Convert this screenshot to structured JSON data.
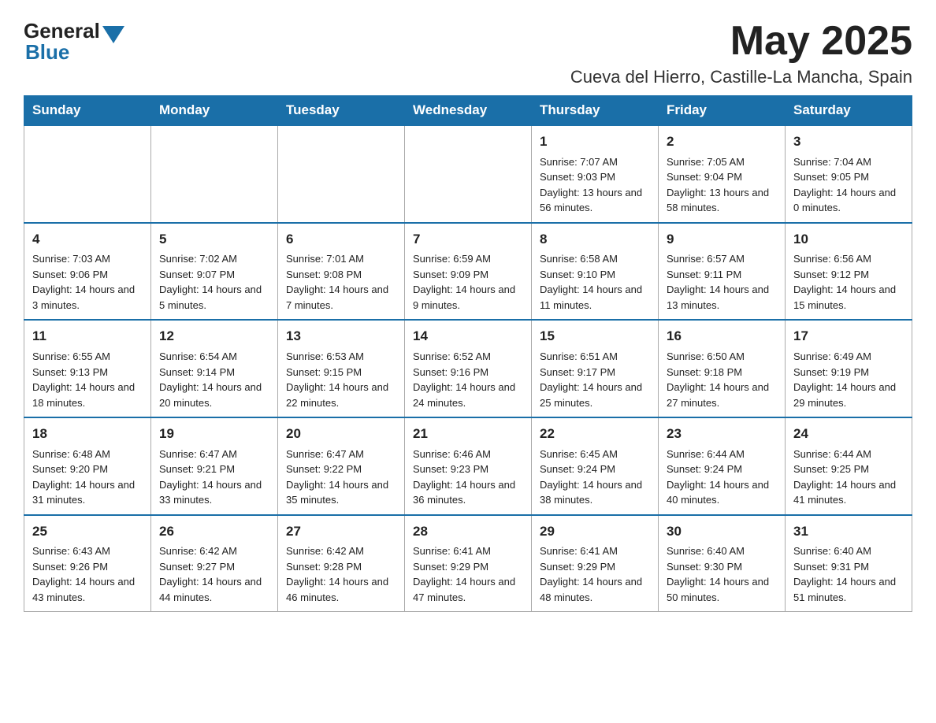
{
  "logo": {
    "general": "General",
    "blue": "Blue"
  },
  "title": {
    "month_year": "May 2025",
    "location": "Cueva del Hierro, Castille-La Mancha, Spain"
  },
  "weekdays": [
    "Sunday",
    "Monday",
    "Tuesday",
    "Wednesday",
    "Thursday",
    "Friday",
    "Saturday"
  ],
  "weeks": [
    [
      {
        "day": "",
        "info": ""
      },
      {
        "day": "",
        "info": ""
      },
      {
        "day": "",
        "info": ""
      },
      {
        "day": "",
        "info": ""
      },
      {
        "day": "1",
        "info": "Sunrise: 7:07 AM\nSunset: 9:03 PM\nDaylight: 13 hours and 56 minutes."
      },
      {
        "day": "2",
        "info": "Sunrise: 7:05 AM\nSunset: 9:04 PM\nDaylight: 13 hours and 58 minutes."
      },
      {
        "day": "3",
        "info": "Sunrise: 7:04 AM\nSunset: 9:05 PM\nDaylight: 14 hours and 0 minutes."
      }
    ],
    [
      {
        "day": "4",
        "info": "Sunrise: 7:03 AM\nSunset: 9:06 PM\nDaylight: 14 hours and 3 minutes."
      },
      {
        "day": "5",
        "info": "Sunrise: 7:02 AM\nSunset: 9:07 PM\nDaylight: 14 hours and 5 minutes."
      },
      {
        "day": "6",
        "info": "Sunrise: 7:01 AM\nSunset: 9:08 PM\nDaylight: 14 hours and 7 minutes."
      },
      {
        "day": "7",
        "info": "Sunrise: 6:59 AM\nSunset: 9:09 PM\nDaylight: 14 hours and 9 minutes."
      },
      {
        "day": "8",
        "info": "Sunrise: 6:58 AM\nSunset: 9:10 PM\nDaylight: 14 hours and 11 minutes."
      },
      {
        "day": "9",
        "info": "Sunrise: 6:57 AM\nSunset: 9:11 PM\nDaylight: 14 hours and 13 minutes."
      },
      {
        "day": "10",
        "info": "Sunrise: 6:56 AM\nSunset: 9:12 PM\nDaylight: 14 hours and 15 minutes."
      }
    ],
    [
      {
        "day": "11",
        "info": "Sunrise: 6:55 AM\nSunset: 9:13 PM\nDaylight: 14 hours and 18 minutes."
      },
      {
        "day": "12",
        "info": "Sunrise: 6:54 AM\nSunset: 9:14 PM\nDaylight: 14 hours and 20 minutes."
      },
      {
        "day": "13",
        "info": "Sunrise: 6:53 AM\nSunset: 9:15 PM\nDaylight: 14 hours and 22 minutes."
      },
      {
        "day": "14",
        "info": "Sunrise: 6:52 AM\nSunset: 9:16 PM\nDaylight: 14 hours and 24 minutes."
      },
      {
        "day": "15",
        "info": "Sunrise: 6:51 AM\nSunset: 9:17 PM\nDaylight: 14 hours and 25 minutes."
      },
      {
        "day": "16",
        "info": "Sunrise: 6:50 AM\nSunset: 9:18 PM\nDaylight: 14 hours and 27 minutes."
      },
      {
        "day": "17",
        "info": "Sunrise: 6:49 AM\nSunset: 9:19 PM\nDaylight: 14 hours and 29 minutes."
      }
    ],
    [
      {
        "day": "18",
        "info": "Sunrise: 6:48 AM\nSunset: 9:20 PM\nDaylight: 14 hours and 31 minutes."
      },
      {
        "day": "19",
        "info": "Sunrise: 6:47 AM\nSunset: 9:21 PM\nDaylight: 14 hours and 33 minutes."
      },
      {
        "day": "20",
        "info": "Sunrise: 6:47 AM\nSunset: 9:22 PM\nDaylight: 14 hours and 35 minutes."
      },
      {
        "day": "21",
        "info": "Sunrise: 6:46 AM\nSunset: 9:23 PM\nDaylight: 14 hours and 36 minutes."
      },
      {
        "day": "22",
        "info": "Sunrise: 6:45 AM\nSunset: 9:24 PM\nDaylight: 14 hours and 38 minutes."
      },
      {
        "day": "23",
        "info": "Sunrise: 6:44 AM\nSunset: 9:24 PM\nDaylight: 14 hours and 40 minutes."
      },
      {
        "day": "24",
        "info": "Sunrise: 6:44 AM\nSunset: 9:25 PM\nDaylight: 14 hours and 41 minutes."
      }
    ],
    [
      {
        "day": "25",
        "info": "Sunrise: 6:43 AM\nSunset: 9:26 PM\nDaylight: 14 hours and 43 minutes."
      },
      {
        "day": "26",
        "info": "Sunrise: 6:42 AM\nSunset: 9:27 PM\nDaylight: 14 hours and 44 minutes."
      },
      {
        "day": "27",
        "info": "Sunrise: 6:42 AM\nSunset: 9:28 PM\nDaylight: 14 hours and 46 minutes."
      },
      {
        "day": "28",
        "info": "Sunrise: 6:41 AM\nSunset: 9:29 PM\nDaylight: 14 hours and 47 minutes."
      },
      {
        "day": "29",
        "info": "Sunrise: 6:41 AM\nSunset: 9:29 PM\nDaylight: 14 hours and 48 minutes."
      },
      {
        "day": "30",
        "info": "Sunrise: 6:40 AM\nSunset: 9:30 PM\nDaylight: 14 hours and 50 minutes."
      },
      {
        "day": "31",
        "info": "Sunrise: 6:40 AM\nSunset: 9:31 PM\nDaylight: 14 hours and 51 minutes."
      }
    ]
  ]
}
